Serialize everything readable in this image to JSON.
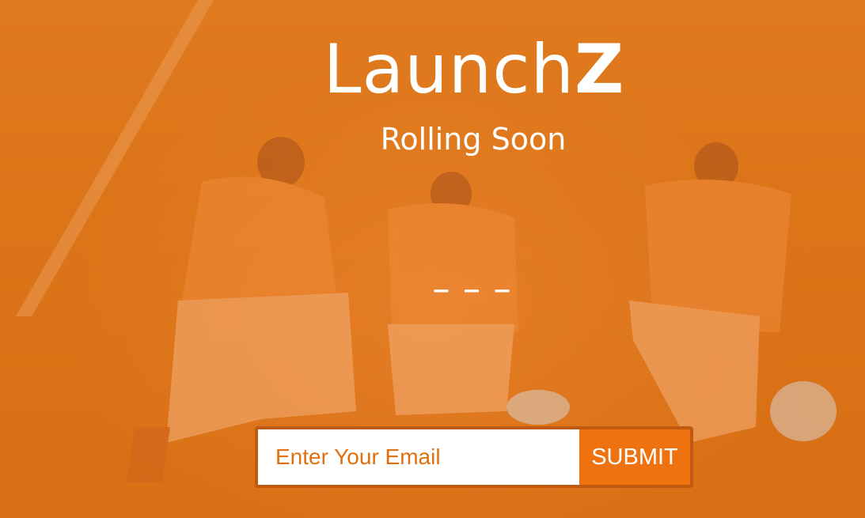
{
  "brand": {
    "name_regular": "Launch",
    "name_accent": "Z"
  },
  "tagline": "Rolling Soon",
  "countdown": "_ _ _",
  "subscribe": {
    "email_placeholder": "Enter Your Email",
    "submit_label": "SUBMIT"
  },
  "colors": {
    "overlay": "#e0761a",
    "button": "#ef7210",
    "input_text": "#e06f10",
    "border": "#c05a10"
  }
}
